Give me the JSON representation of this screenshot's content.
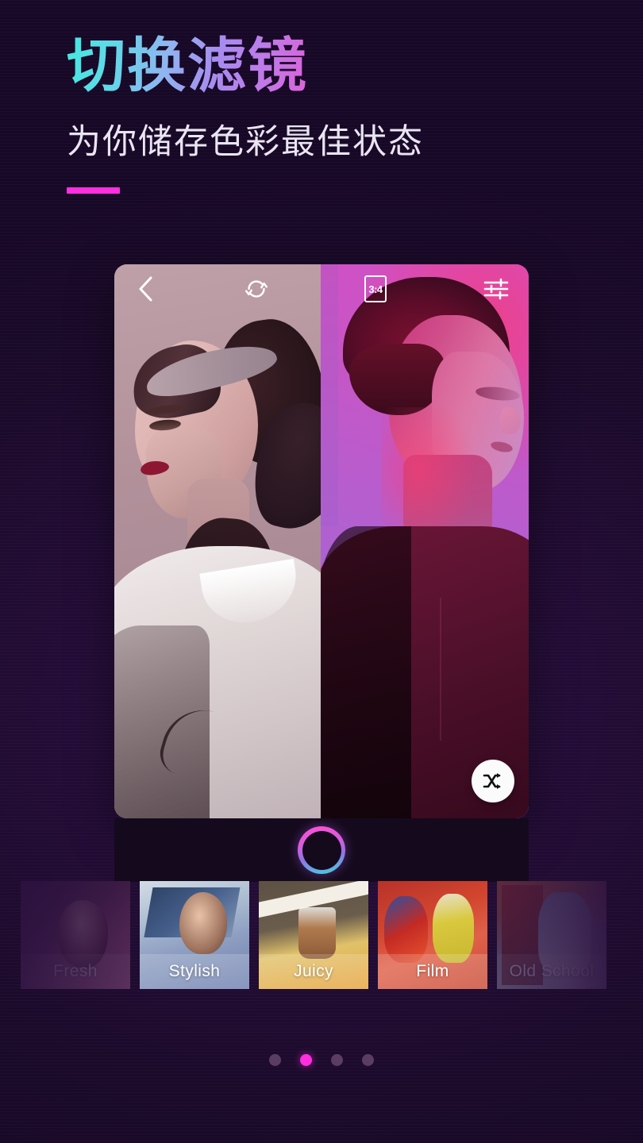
{
  "promo": {
    "headline": "切换滤镜",
    "subheadline": "为你储存色彩最佳状态"
  },
  "colors": {
    "background": "#1b0a2a",
    "accent_pink": "#ff2fe0",
    "headline_gradient_start": "#45e8e0",
    "headline_gradient_mid": "#a78cf0",
    "headline_gradient_end": "#ff2f86",
    "shutter_gradient_top": "#ff4fd0",
    "shutter_gradient_bottom": "#3fd6e0",
    "app_bar_dark": "#150a1d"
  },
  "app": {
    "toolbar": {
      "back_icon": "chevron-left-icon",
      "rotate_icon": "rotate-refresh-icon",
      "aspect_ratio_label": "3:4",
      "adjust_icon": "sliders-adjust-icon"
    },
    "canvas": {
      "left_photo_alt": "woman-portrait-rose-filter",
      "right_photo_alt": "man-portrait-magenta-filter",
      "shuffle_icon": "shuffle-icon"
    },
    "shutter": {
      "label": "shutter-button"
    }
  },
  "filters": [
    {
      "name": "Fresh",
      "state": "faded-left"
    },
    {
      "name": "Stylish",
      "state": "normal"
    },
    {
      "name": "Juicy",
      "state": "normal"
    },
    {
      "name": "Film",
      "state": "normal"
    },
    {
      "name": "Old School",
      "state": "faded-right"
    }
  ],
  "pagination": {
    "total": 4,
    "active_index": 1
  }
}
